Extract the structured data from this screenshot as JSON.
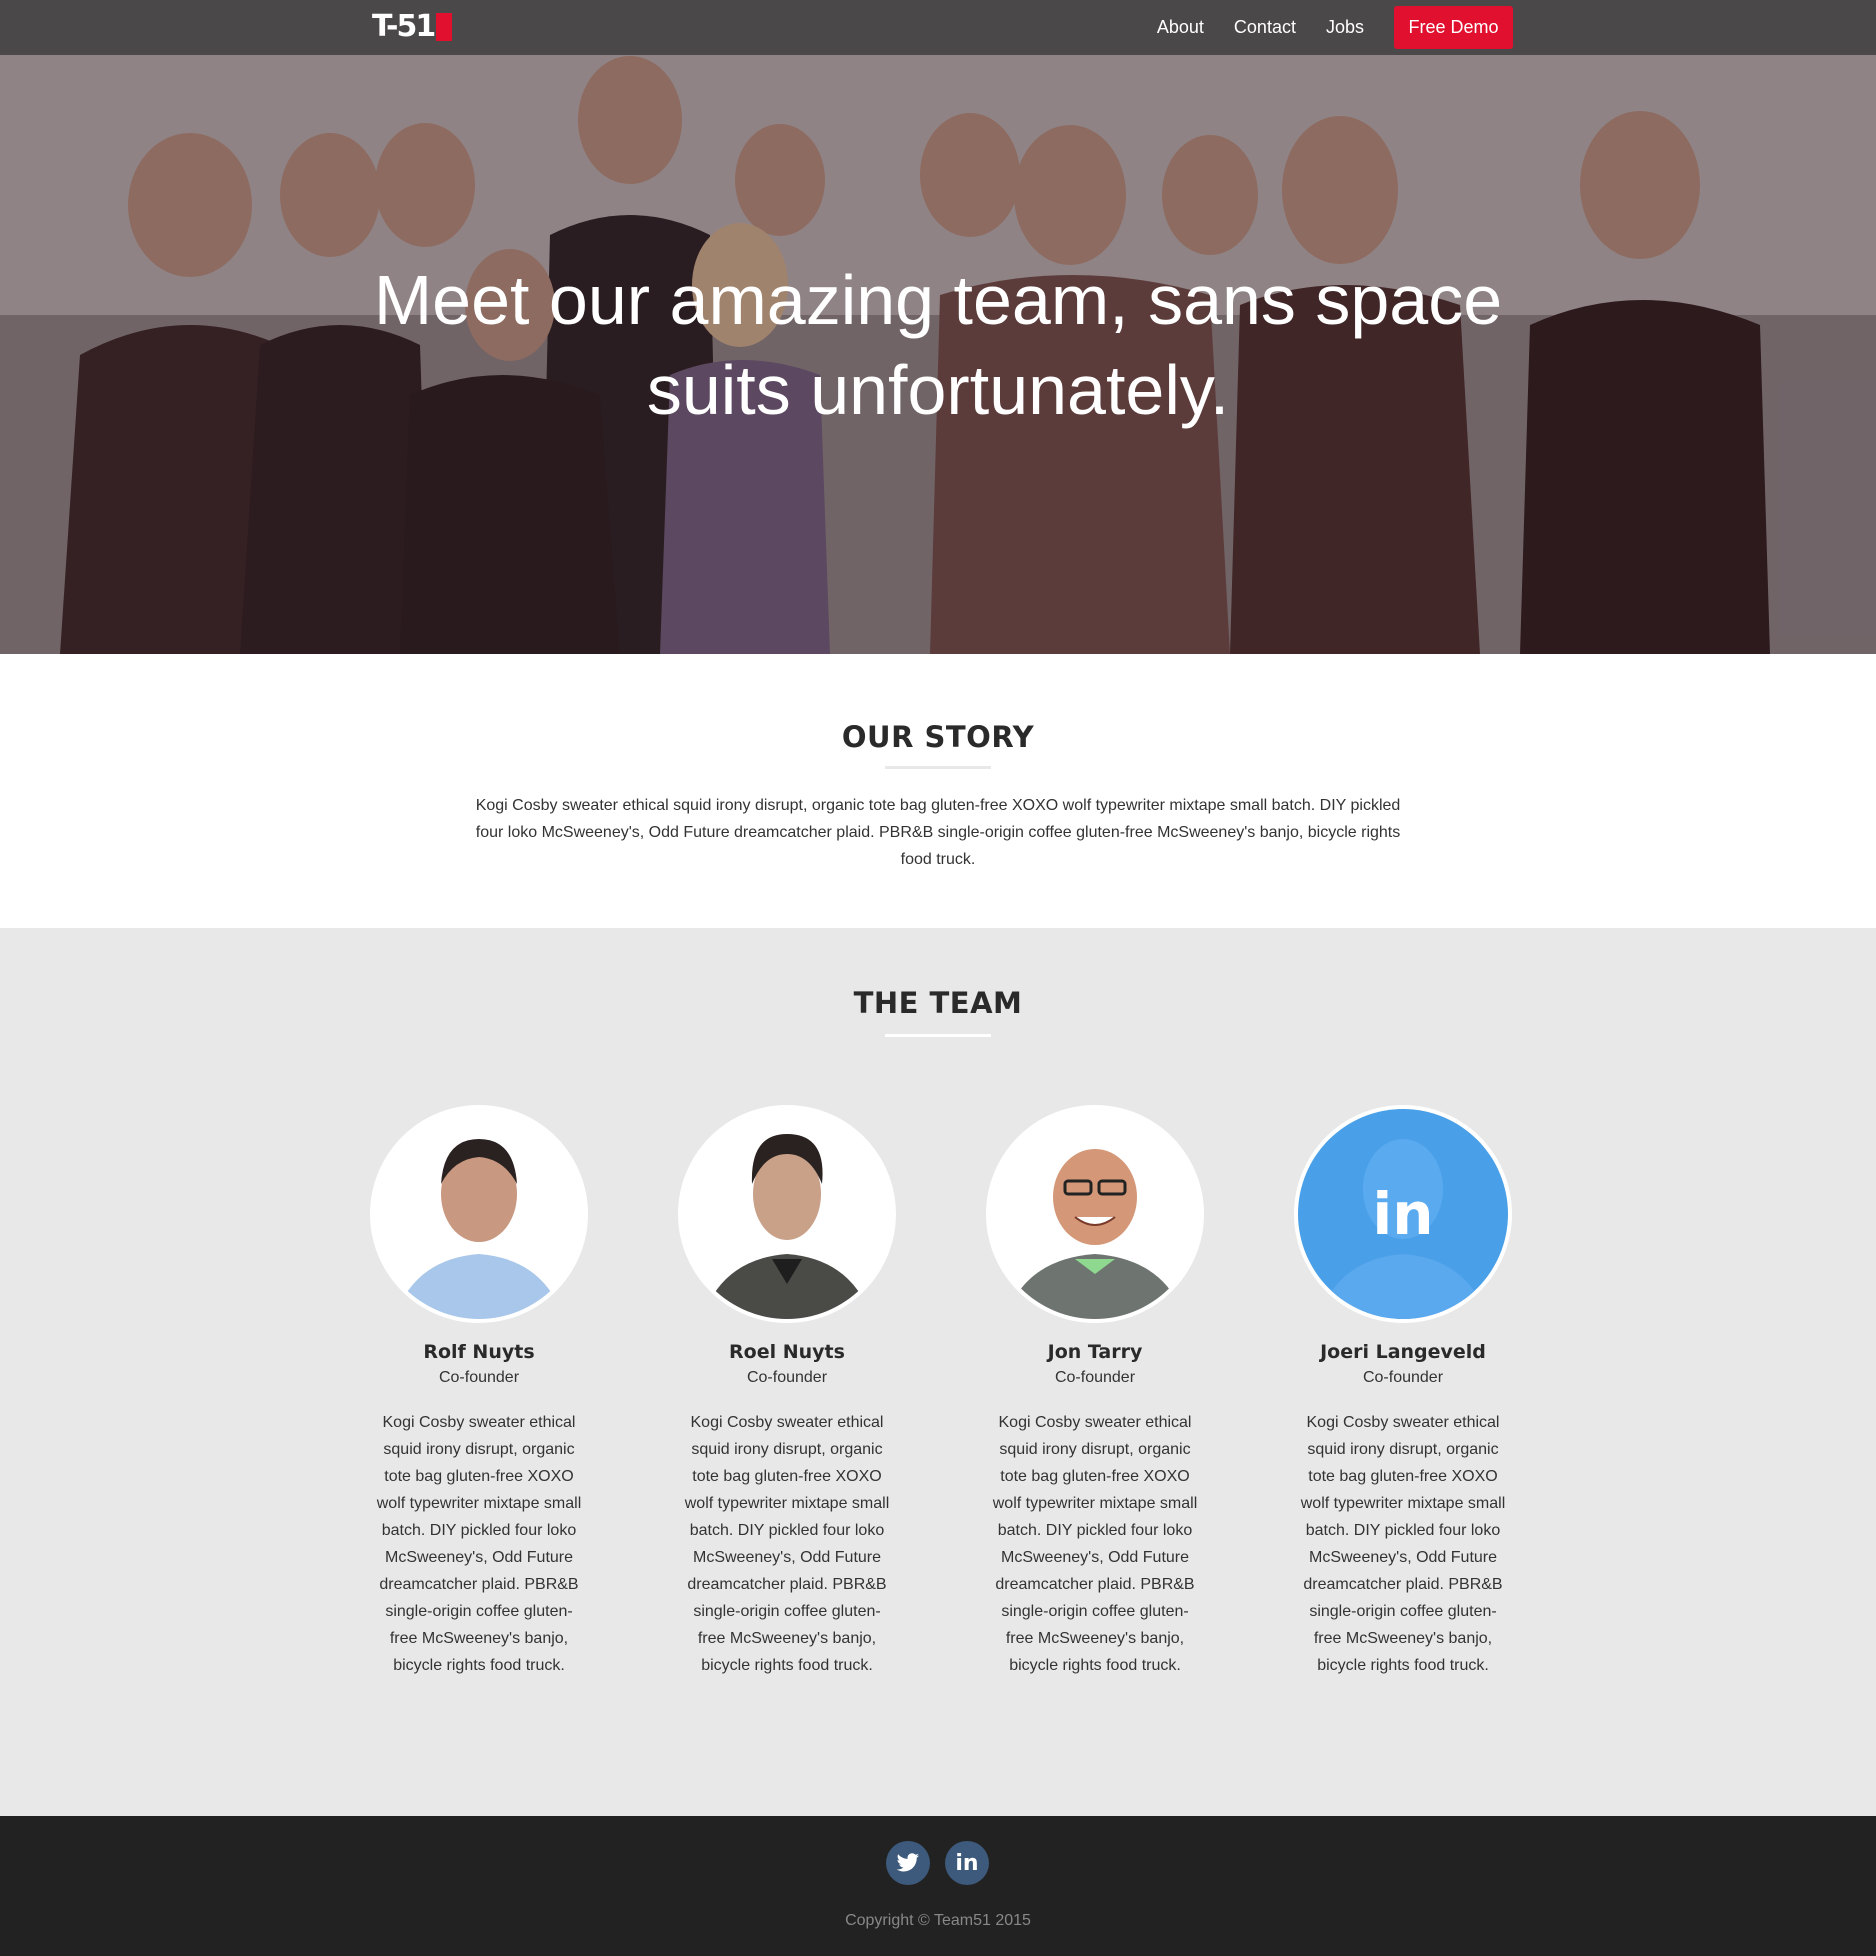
{
  "nav": {
    "logo_text": "T-51",
    "links": [
      "About",
      "Contact",
      "Jobs"
    ],
    "cta_label": "Free Demo",
    "brand_color": "#e0102e"
  },
  "hero": {
    "headline": "Meet our amazing team, sans space suits unfortunately."
  },
  "story": {
    "title": "OUR STORY",
    "text": "Kogi Cosby sweater ethical squid irony disrupt, organic tote bag gluten-free XOXO wolf typewriter mixtape small batch. DIY pickled four loko McSweeney's, Odd Future dreamcatcher plaid. PBR&B single-origin coffee gluten-free McSweeney's banjo, bicycle rights food truck."
  },
  "team": {
    "title": "THE TEAM",
    "members": [
      {
        "name": "Rolf Nuyts",
        "role": "Co-founder",
        "bio": "Kogi Cosby sweater ethical squid irony disrupt, organic tote bag gluten-free XOXO wolf typewriter mixtape small batch. DIY pickled four loko McSweeney's, Odd Future dreamcatcher plaid. PBR&B single-origin coffee gluten-free McSweeney's banjo, bicycle rights food truck."
      },
      {
        "name": "Roel Nuyts",
        "role": "Co-founder",
        "bio": "Kogi Cosby sweater ethical squid irony disrupt, organic tote bag gluten-free XOXO wolf typewriter mixtape small batch. DIY pickled four loko McSweeney's, Odd Future dreamcatcher plaid. PBR&B single-origin coffee gluten-free McSweeney's banjo, bicycle rights food truck."
      },
      {
        "name": "Jon Tarry",
        "role": "Co-founder",
        "bio": "Kogi Cosby sweater ethical squid irony disrupt, organic tote bag gluten-free XOXO wolf typewriter mixtape small batch. DIY pickled four loko McSweeney's, Odd Future dreamcatcher plaid. PBR&B single-origin coffee gluten-free McSweeney's banjo, bicycle rights food truck."
      },
      {
        "name": "Joeri Langeveld",
        "role": "Co-founder",
        "bio": "Kogi Cosby sweater ethical squid irony disrupt, organic tote bag gluten-free XOXO wolf typewriter mixtape small batch. DIY pickled four loko McSweeney's, Odd Future dreamcatcher plaid. PBR&B single-origin coffee gluten-free McSweeney's banjo, bicycle rights food truck.",
        "hover_icon": "linkedin-icon"
      }
    ]
  },
  "footer": {
    "social": [
      "twitter-icon",
      "linkedin-icon"
    ],
    "copyright": "Copyright © Team51 2015"
  }
}
